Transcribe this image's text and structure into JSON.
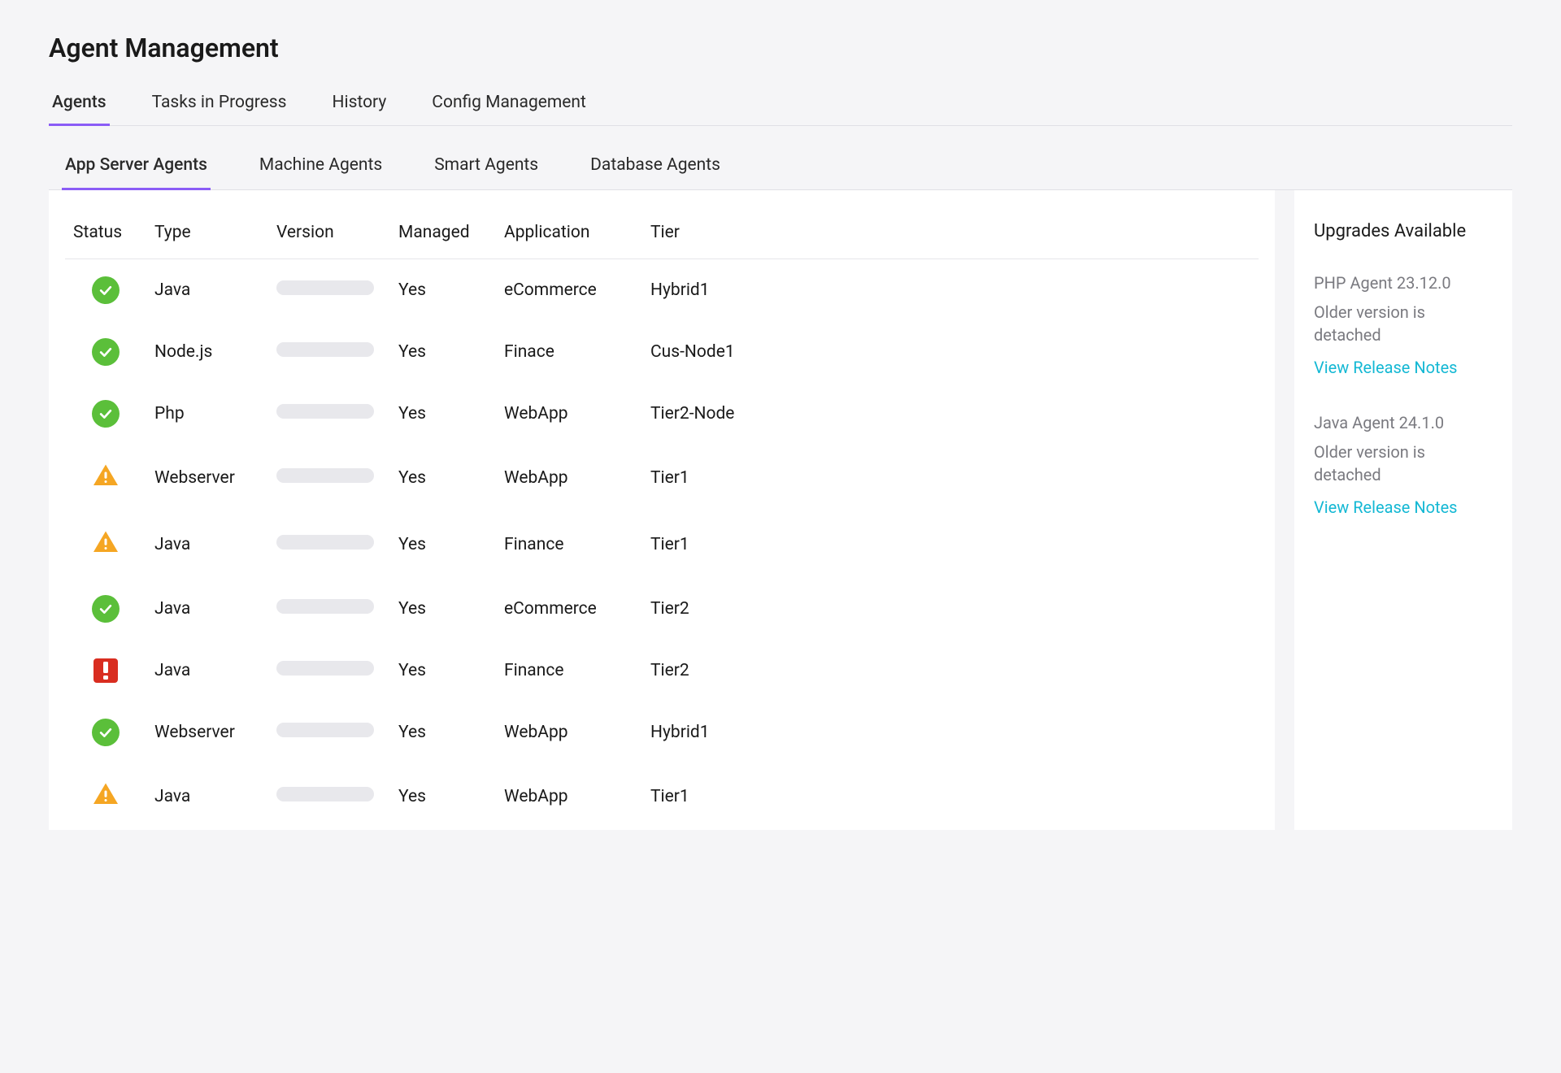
{
  "page_title": "Agent Management",
  "top_tabs": [
    {
      "label": "Agents",
      "active": true
    },
    {
      "label": "Tasks in Progress",
      "active": false
    },
    {
      "label": "History",
      "active": false
    },
    {
      "label": "Config Management",
      "active": false
    }
  ],
  "sub_tabs": [
    {
      "label": "App Server Agents",
      "active": true
    },
    {
      "label": "Machine Agents",
      "active": false
    },
    {
      "label": "Smart Agents",
      "active": false
    },
    {
      "label": "Database Agents",
      "active": false
    }
  ],
  "table": {
    "headers": {
      "status": "Status",
      "type": "Type",
      "version": "Version",
      "managed": "Managed",
      "application": "Application",
      "tier": "Tier"
    },
    "rows": [
      {
        "status": "ok",
        "type": "Java",
        "managed": "Yes",
        "application": "eCommerce",
        "tier": "Hybrid1"
      },
      {
        "status": "ok",
        "type": "Node.js",
        "managed": "Yes",
        "application": "Finace",
        "tier": "Cus-Node1"
      },
      {
        "status": "ok",
        "type": "Php",
        "managed": "Yes",
        "application": "WebApp",
        "tier": "Tier2-Node"
      },
      {
        "status": "warn",
        "type": "Webserver",
        "managed": "Yes",
        "application": "WebApp",
        "tier": "Tier1"
      },
      {
        "status": "warn",
        "type": "Java",
        "managed": "Yes",
        "application": "Finance",
        "tier": "Tier1"
      },
      {
        "status": "ok",
        "type": "Java",
        "managed": "Yes",
        "application": "eCommerce",
        "tier": "Tier2"
      },
      {
        "status": "error",
        "type": "Java",
        "managed": "Yes",
        "application": "Finance",
        "tier": "Tier2"
      },
      {
        "status": "ok",
        "type": "Webserver",
        "managed": "Yes",
        "application": "WebApp",
        "tier": "Hybrid1"
      },
      {
        "status": "warn",
        "type": "Java",
        "managed": "Yes",
        "application": "WebApp",
        "tier": "Tier1"
      }
    ]
  },
  "side": {
    "title": "Upgrades Available",
    "upgrades": [
      {
        "name": "PHP Agent 23.12.0",
        "note": "Older version is detached",
        "link_label": "View Release Notes"
      },
      {
        "name": "Java Agent 24.1.0",
        "note": "Older version is detached",
        "link_label": "View Release Notes"
      }
    ]
  }
}
